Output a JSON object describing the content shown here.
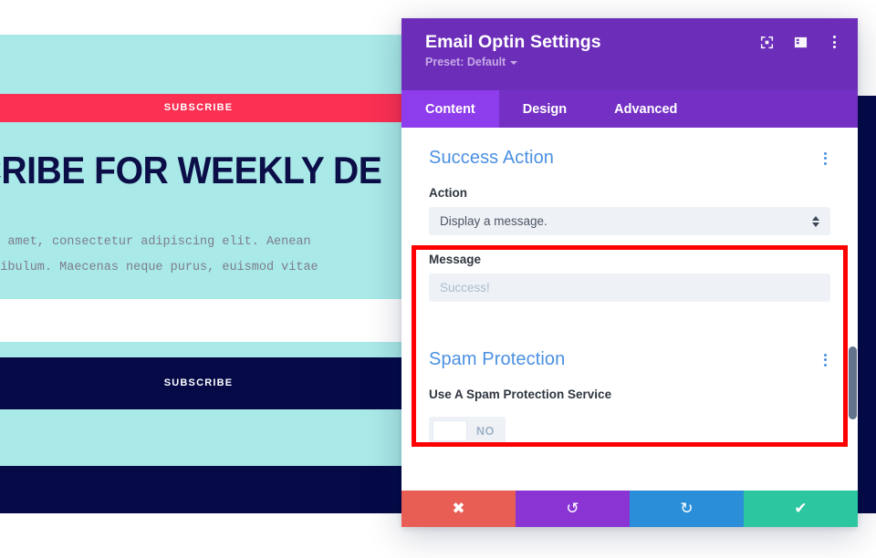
{
  "background": {
    "heading": "SCRIBE FOR WEEKLY DE",
    "body_line_1": "sit amet, consectetur adipiscing elit. Aenean",
    "body_line_2": "estibulum. Maecenas neque purus, euismod vitae",
    "subscribe_button_1": "SUBSCRIBE",
    "subscribe_button_2": "SUBSCRIBE",
    "colors": {
      "cyan": "#a9e9e8",
      "pink": "#fb3053",
      "navy": "#050a47",
      "heading_text": "#0c0e48"
    }
  },
  "modal": {
    "title": "Email Optin Settings",
    "preset_label": "Preset: Default",
    "header_icons": [
      {
        "name": "focus-target-icon"
      },
      {
        "name": "layout-panel-icon"
      },
      {
        "name": "more-options-icon"
      }
    ],
    "tabs": [
      {
        "label": "Content",
        "active": true
      },
      {
        "label": "Design",
        "active": false
      },
      {
        "label": "Advanced",
        "active": false
      }
    ],
    "sections": [
      {
        "title": "Success Action",
        "highlighted": true,
        "fields": [
          {
            "label": "Action",
            "type": "select",
            "value": "Display a message."
          },
          {
            "label": "Message",
            "type": "text",
            "value": "",
            "placeholder": "Success!"
          }
        ]
      },
      {
        "title": "Spam Protection",
        "highlighted": false,
        "fields": [
          {
            "label": "Use A Spam Protection Service",
            "type": "toggle",
            "value": "NO"
          }
        ]
      }
    ],
    "footer_buttons": [
      {
        "name": "cancel-button",
        "glyph": "✖"
      },
      {
        "name": "undo-button",
        "glyph": "↺"
      },
      {
        "name": "redo-button",
        "glyph": "↻"
      },
      {
        "name": "save-button",
        "glyph": "✔"
      }
    ],
    "colors": {
      "header_purple": "#6c2eb9",
      "tab_bar_purple": "#7430c4",
      "tab_active_purple": "#8e3ded",
      "section_title_blue": "#4a90e2",
      "highlight_red": "#fe0000",
      "cancel": "#e85d54",
      "undo": "#8a34d4",
      "redo": "#2a8fd8",
      "save": "#2cc6a0"
    }
  }
}
